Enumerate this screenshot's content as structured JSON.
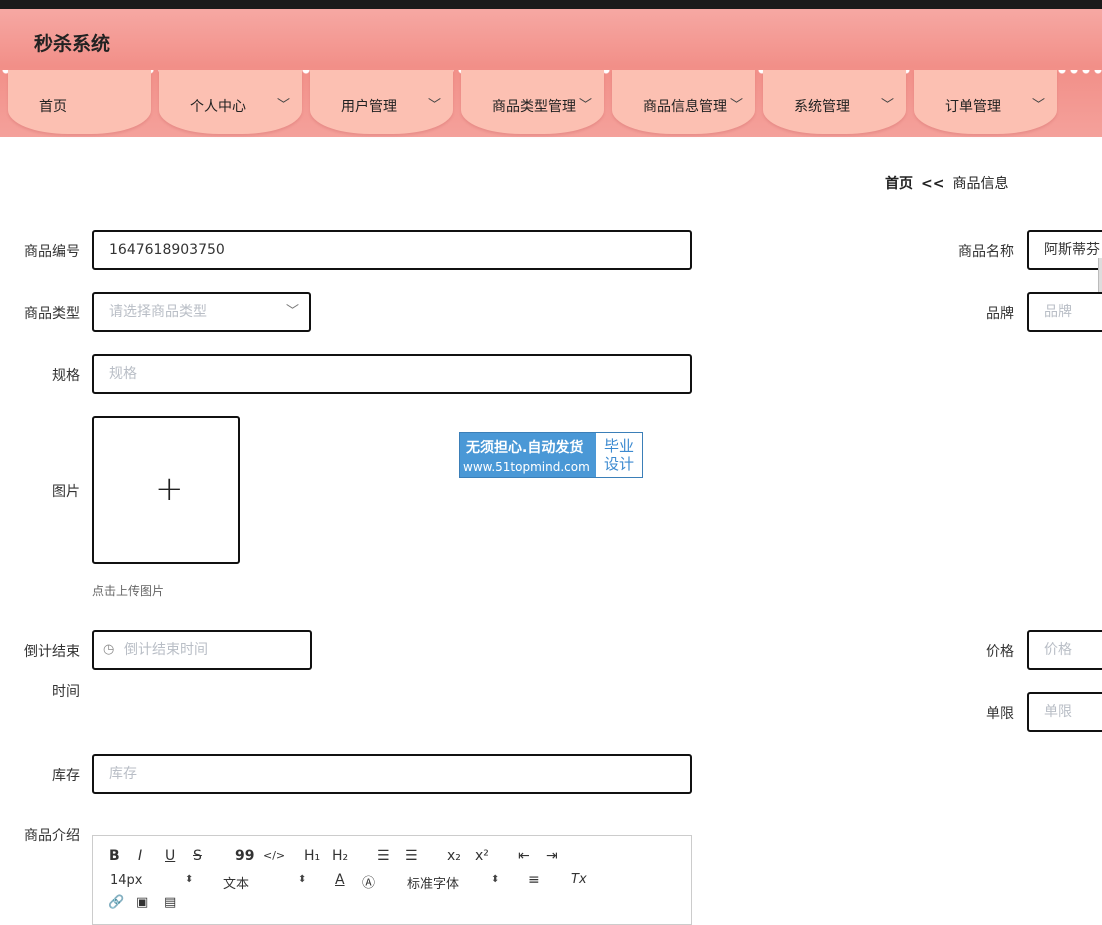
{
  "app": {
    "title": "秒杀系统"
  },
  "nav": {
    "items": [
      {
        "label": "首页",
        "caret": ""
      },
      {
        "label": "个人中心",
        "caret": "﹀"
      },
      {
        "label": "用户管理",
        "caret": "﹀"
      },
      {
        "label": "商品类型管理",
        "caret": "﹀"
      },
      {
        "label": "商品信息管理",
        "caret": "﹀"
      },
      {
        "label": "系统管理",
        "caret": "﹀"
      },
      {
        "label": "订单管理",
        "caret": "﹀"
      }
    ]
  },
  "breadcrumb": {
    "home": "首页",
    "separator": "<<",
    "current": "商品信息"
  },
  "form": {
    "product_no": {
      "label": "商品编号",
      "value": "1647618903750"
    },
    "product_name": {
      "label": "商品名称",
      "value": "阿斯蒂芬"
    },
    "product_type": {
      "label": "商品类型",
      "placeholder": "请选择商品类型"
    },
    "brand": {
      "label": "品牌",
      "placeholder": "品牌"
    },
    "spec": {
      "label": "规格",
      "placeholder": "规格"
    },
    "image": {
      "label": "图片",
      "plus": "+",
      "tip": "点击上传图片"
    },
    "countdown": {
      "label_line1": "倒计结束",
      "label_line2": "时间",
      "placeholder": "倒计结束时间"
    },
    "price": {
      "label": "价格",
      "placeholder": "价格"
    },
    "limit": {
      "label": "单限",
      "placeholder": "单限"
    },
    "stock": {
      "label": "库存",
      "placeholder": "库存"
    },
    "intro": {
      "label": "商品介绍"
    }
  },
  "editor": {
    "bold": "B",
    "italic": "I",
    "underline": "U",
    "strike": "S",
    "quote": "99",
    "code": "</>",
    "h1": "H₁",
    "h2": "H₂",
    "ol": "☰",
    "ul": "☰",
    "sub": "x₂",
    "sup": "x²",
    "indent_dec": "⇤",
    "indent_inc": "⇥",
    "size": "14px",
    "header": "文本",
    "color": "A",
    "bg": "Ⓐ",
    "font": "标准字体",
    "align": "≡",
    "clean": "Tx",
    "link": "🔗",
    "image": "▣",
    "video": "▤"
  },
  "watermark": {
    "line1": "无须担心.自动发货",
    "line2": "www.51topmind.com",
    "right1": "毕业",
    "right2": "设计"
  },
  "colors": {
    "header": "#f28f88",
    "nav_tab": "#fcc0b2",
    "watermark": "#4a98d6"
  }
}
